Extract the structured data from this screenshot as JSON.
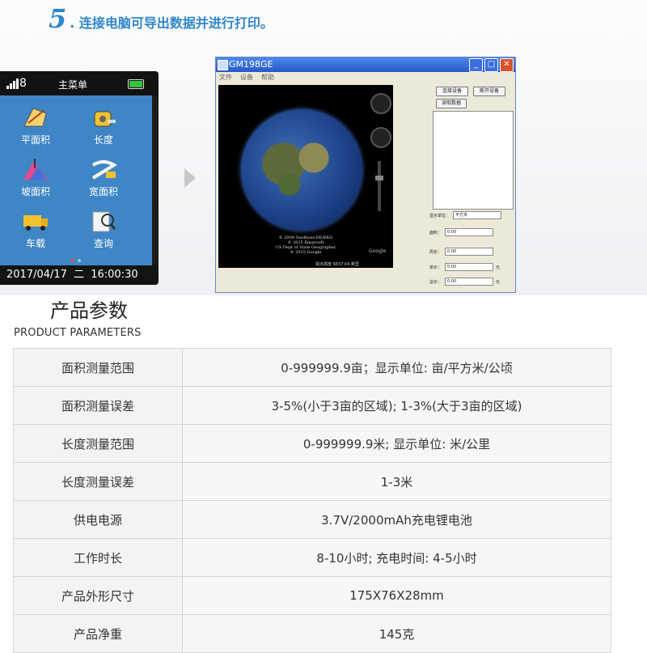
{
  "step": {
    "number": "5",
    "text": ". 连接电脑可导出数据并进行打印。"
  },
  "device": {
    "signal_count": "8",
    "menu_title": "主菜单",
    "menu_items": [
      {
        "label": "平面积",
        "icon": "plane-area-icon"
      },
      {
        "label": "长度",
        "icon": "tape-measure-icon"
      },
      {
        "label": "坡面积",
        "icon": "slope-area-icon"
      },
      {
        "label": "宽面积",
        "icon": "width-area-icon"
      },
      {
        "label": "车载",
        "icon": "truck-icon"
      },
      {
        "label": "查询",
        "icon": "search-icon"
      }
    ],
    "date": "2017/04/17",
    "weekday": "二",
    "time": "16:00:30",
    "screen_color": "#3f86c6"
  },
  "app": {
    "title": "GM198GE",
    "menu": [
      "文件",
      "设备",
      "帮助"
    ],
    "buttons": {
      "connect": "连接设备",
      "disconnect": "断开设备",
      "read": "读取数据"
    },
    "map_credit": "© 2009 GeoBasis-DE/BKG\n© 2015 Basarsoft\nUS Dept of State Geographer\n© 2015 Google",
    "google_logo": "Google",
    "coord_readout": "视点高度   6837.04 英里",
    "fields": [
      {
        "label": "显示单位：",
        "value": "平方米",
        "unit": ""
      },
      {
        "label": "面积：",
        "value": "0.00",
        "unit": ""
      },
      {
        "label": "周长：",
        "value": "0.00",
        "unit": ""
      },
      {
        "label": "单价：",
        "value": "0.00",
        "unit": "元"
      },
      {
        "label": "总价：",
        "value": "0.00",
        "unit": "元"
      }
    ]
  },
  "params": {
    "title": "产品参数",
    "subtitle": "PRODUCT PARAMETERS",
    "rows": [
      {
        "key": "面积测量范围",
        "value": "0-999999.9亩；显示单位: 亩/平方米/公顷"
      },
      {
        "key": "面积测量误差",
        "value": "3-5%(小于3亩的区域); 1-3%(大于3亩的区域)"
      },
      {
        "key": "长度测量范围",
        "value": "0-999999.9米; 显示单位: 米/公里"
      },
      {
        "key": "长度测量误差",
        "value": "1-3米"
      },
      {
        "key": "供电电源",
        "value": "3.7V/2000mAh充电锂电池"
      },
      {
        "key": "工作时长",
        "value": "8-10小时; 充电时间: 4-5小时"
      },
      {
        "key": "产品外形尺寸",
        "value": "175X76X28mm"
      },
      {
        "key": "产品净重",
        "value": "145克"
      }
    ]
  },
  "colors": {
    "accent": "#2f86c8",
    "battery": "#36c23a"
  }
}
